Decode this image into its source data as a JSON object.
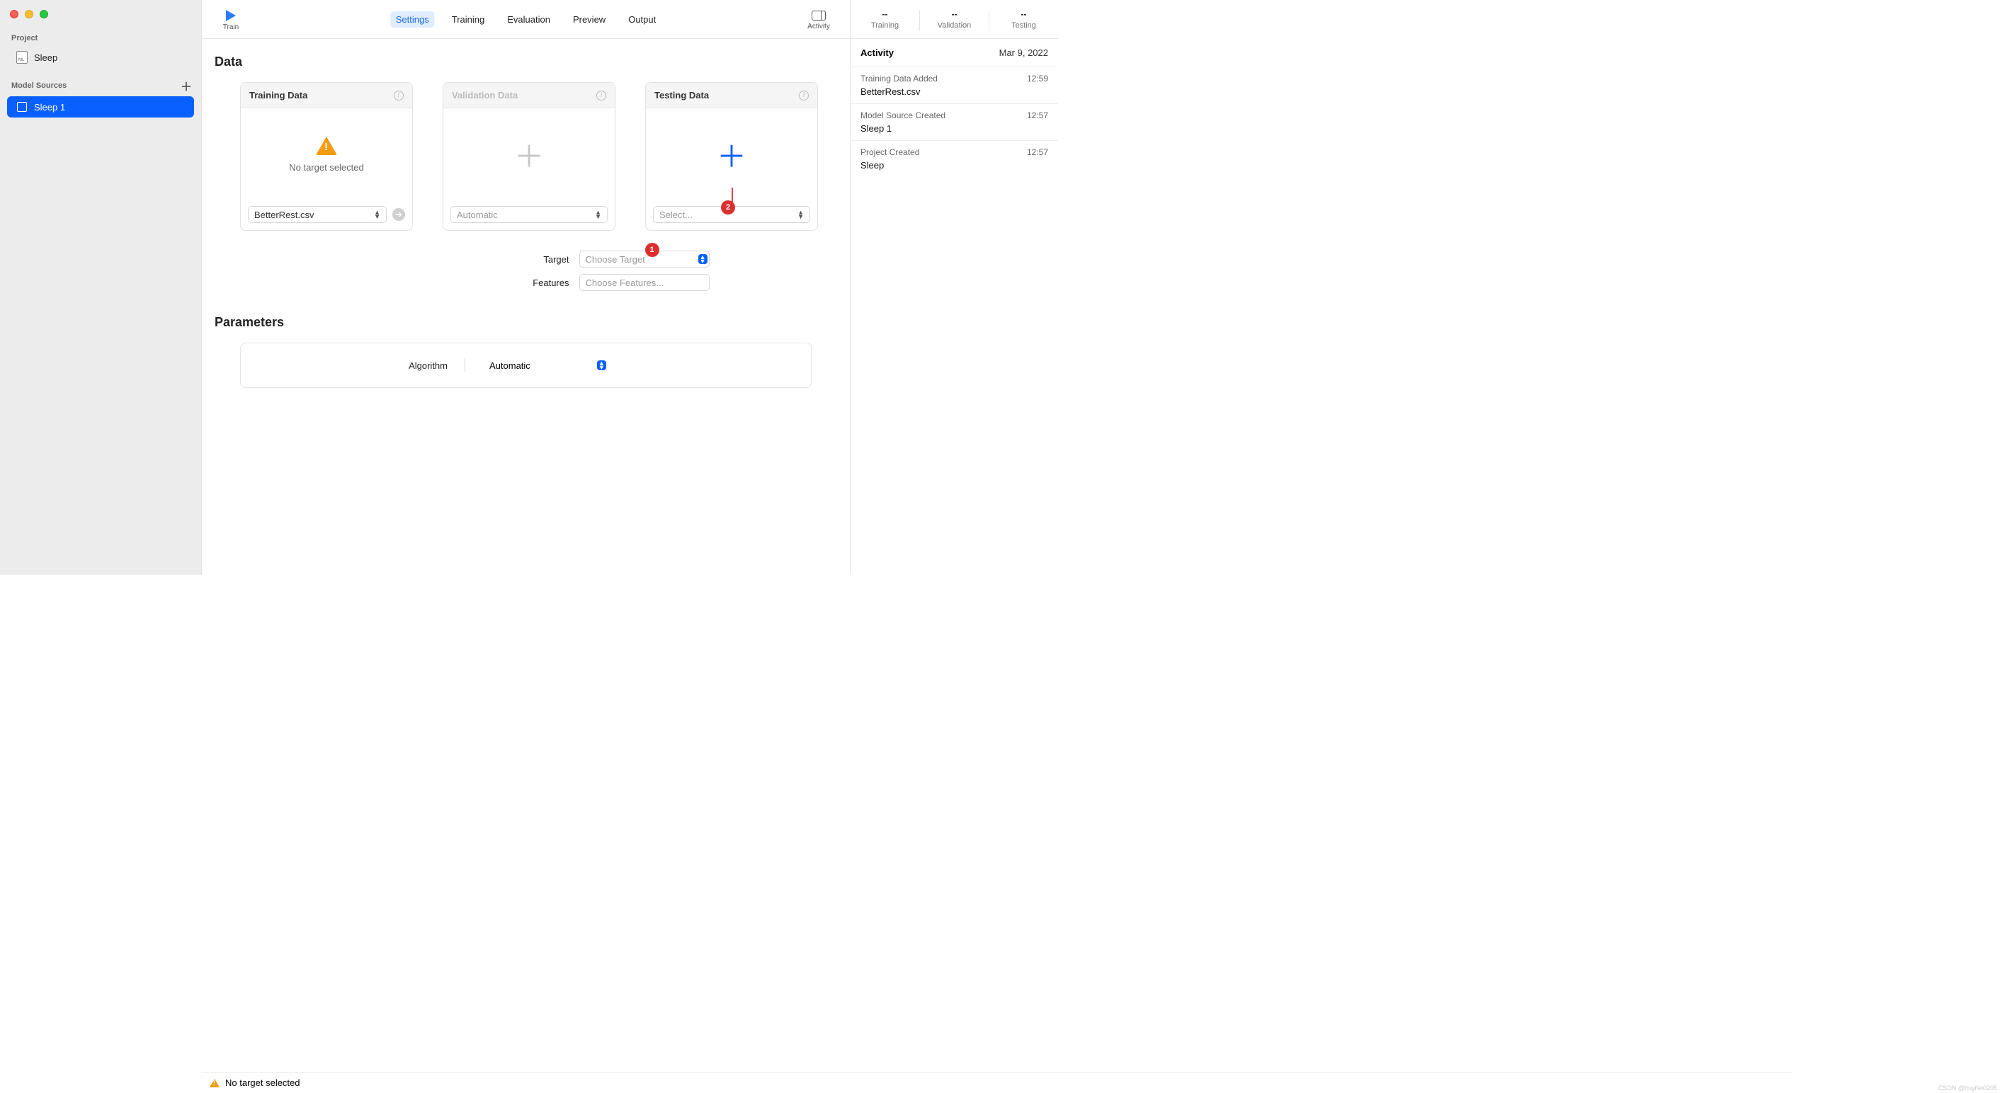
{
  "sidebar": {
    "project_label": "Project",
    "project_item": "Sleep",
    "model_sources_label": "Model Sources",
    "model_items": [
      "Sleep 1"
    ]
  },
  "toolbar": {
    "train_label": "Train",
    "tabs": [
      "Settings",
      "Training",
      "Evaluation",
      "Preview",
      "Output"
    ],
    "active_tab": "Settings",
    "activity_label": "Activity"
  },
  "content": {
    "data_heading": "Data",
    "cards": {
      "training": {
        "title": "Training Data",
        "message": "No target selected",
        "select_value": "BetterRest.csv"
      },
      "validation": {
        "title": "Validation Data",
        "select_value": "Automatic"
      },
      "testing": {
        "title": "Testing Data",
        "select_value": "Select..."
      }
    },
    "target_label": "Target",
    "target_placeholder": "Choose Target",
    "features_label": "Features",
    "features_placeholder": "Choose Features...",
    "parameters_heading": "Parameters",
    "algorithm_label": "Algorithm",
    "algorithm_value": "Automatic",
    "annotations": {
      "badge1": "1",
      "badge2": "2"
    }
  },
  "statusbar": {
    "message": "No target selected"
  },
  "rpanel": {
    "metrics": [
      {
        "value": "--",
        "label": "Training"
      },
      {
        "value": "--",
        "label": "Validation"
      },
      {
        "value": "--",
        "label": "Testing"
      }
    ],
    "activity_title": "Activity",
    "activity_date": "Mar 9, 2022",
    "entries": [
      {
        "title": "Training Data Added",
        "time": "12:59",
        "sub": "BetterRest.csv"
      },
      {
        "title": "Model Source Created",
        "time": "12:57",
        "sub": "Sleep 1"
      },
      {
        "title": "Project Created",
        "time": "12:57",
        "sub": "Sleep"
      }
    ]
  },
  "watermark": "CSDN @huyifei0205"
}
